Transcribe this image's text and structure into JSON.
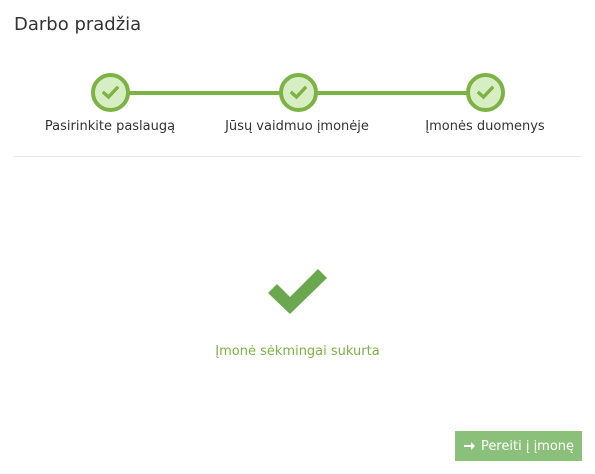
{
  "page": {
    "title": "Darbo pradžia"
  },
  "stepper": {
    "steps": [
      {
        "label": "Pasirinkite paslaugą",
        "status": "completed",
        "icon": "check-icon"
      },
      {
        "label": "Jūsų vaidmuo įmonėje",
        "status": "completed",
        "icon": "check-icon"
      },
      {
        "label": "Įmonės duomenys",
        "status": "completed",
        "icon": "check-icon"
      }
    ]
  },
  "result": {
    "icon": "check-icon",
    "message": "Įmonė sėkmingai sukurta"
  },
  "actions": {
    "go_label": "Pereiti į įmonę",
    "go_icon": "arrow-right-icon"
  },
  "colors": {
    "accent": "#7cb342",
    "step_fill": "#d7eec5",
    "button_bg": "#8bc07a"
  }
}
